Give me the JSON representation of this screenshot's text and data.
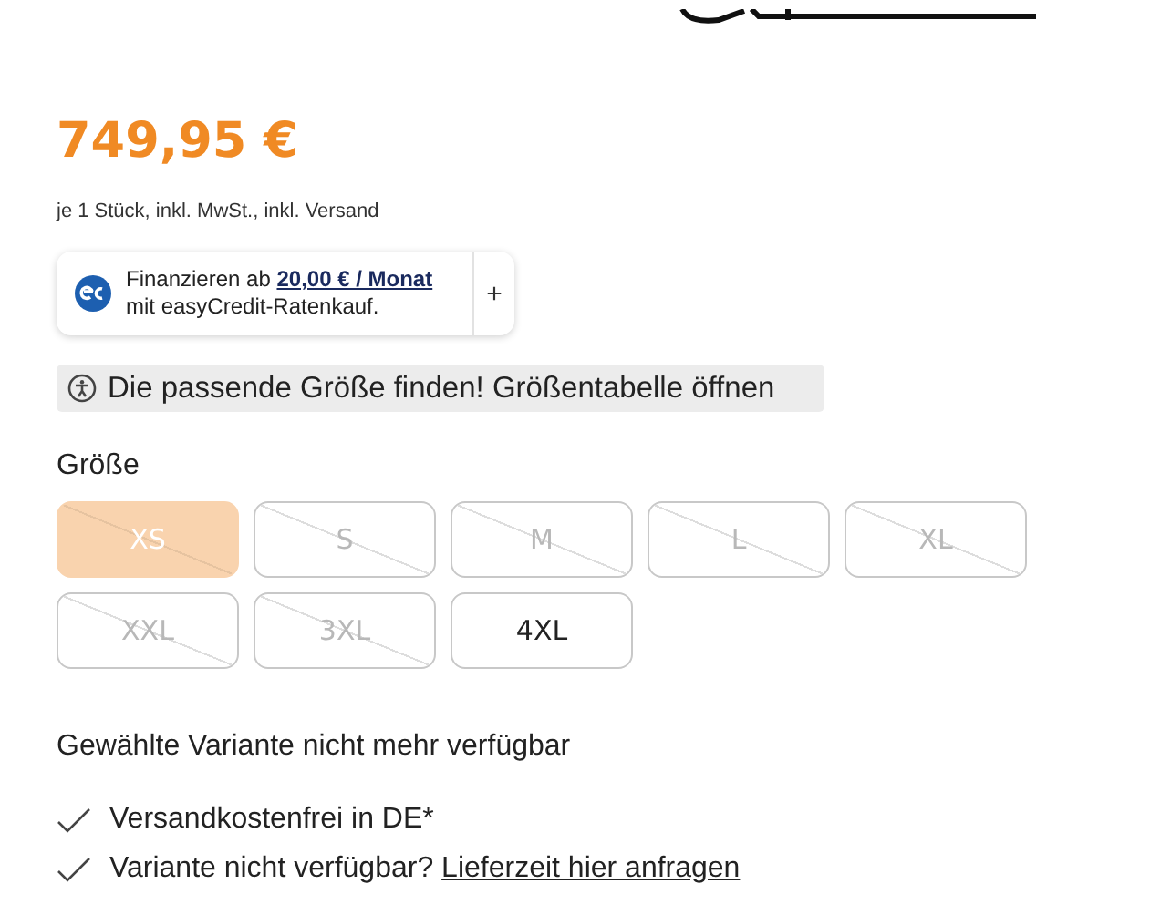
{
  "price": {
    "amount": "749,95 €",
    "note": "je 1 Stück, inkl. MwSt., inkl. Versand"
  },
  "financing": {
    "text": "Finanzieren ab",
    "link": "20,00 € / Monat",
    "line2": "mit easyCredit-Ratenkauf.",
    "expand": "+"
  },
  "size_guide": {
    "label": "Die passende Größe finden! Größentabelle öffnen"
  },
  "sizes": {
    "label": "Größe",
    "options": [
      {
        "label": "XS",
        "selected": true,
        "available": false
      },
      {
        "label": "S",
        "selected": false,
        "available": false
      },
      {
        "label": "M",
        "selected": false,
        "available": false
      },
      {
        "label": "L",
        "selected": false,
        "available": false
      },
      {
        "label": "XL",
        "selected": false,
        "available": false
      },
      {
        "label": "XXL",
        "selected": false,
        "available": false
      },
      {
        "label": "3XL",
        "selected": false,
        "available": false
      },
      {
        "label": "4XL",
        "selected": false,
        "available": true
      }
    ]
  },
  "availability": "Gewählte Variante nicht mehr verfügbar",
  "benefits": [
    {
      "text": "Versandkostenfrei in DE*"
    },
    {
      "text": "Variante nicht verfügbar?",
      "link": "Lieferzeit hier anfragen"
    }
  ]
}
